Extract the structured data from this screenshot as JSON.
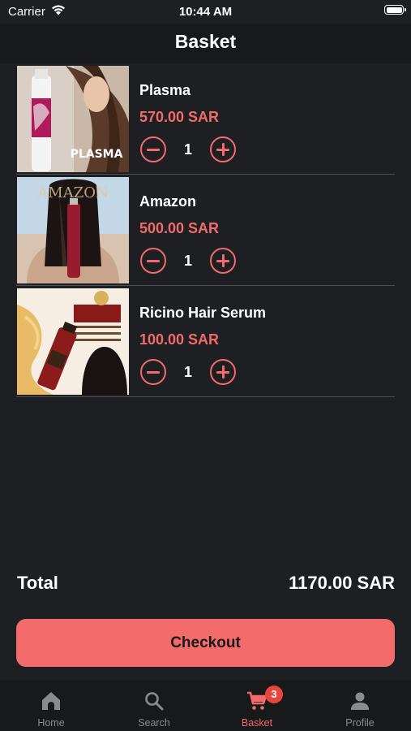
{
  "status_bar": {
    "carrier": "Carrier",
    "time": "10:44 AM"
  },
  "header": {
    "title": "Basket"
  },
  "cart": {
    "items": [
      {
        "name": "Plasma",
        "price": "570.00 SAR",
        "quantity": "1",
        "image_text": "PLASMA"
      },
      {
        "name": "Amazon",
        "price": "500.00 SAR",
        "quantity": "1",
        "image_text": "AMAZON"
      },
      {
        "name": "Ricino Hair Serum",
        "price": "100.00 SAR",
        "quantity": "1"
      }
    ]
  },
  "summary": {
    "total_label": "Total",
    "total_value": "1170.00 SAR"
  },
  "checkout": {
    "label": "Checkout"
  },
  "tab_bar": {
    "tabs": [
      {
        "label": "Home",
        "icon": "home-icon"
      },
      {
        "label": "Search",
        "icon": "search-icon"
      },
      {
        "label": "Basket",
        "icon": "cart-icon",
        "badge": "3",
        "active": true
      },
      {
        "label": "Profile",
        "icon": "person-icon"
      }
    ]
  },
  "colors": {
    "accent": "#f06b6b",
    "background": "#1e1f22",
    "badge": "#e8453c"
  }
}
